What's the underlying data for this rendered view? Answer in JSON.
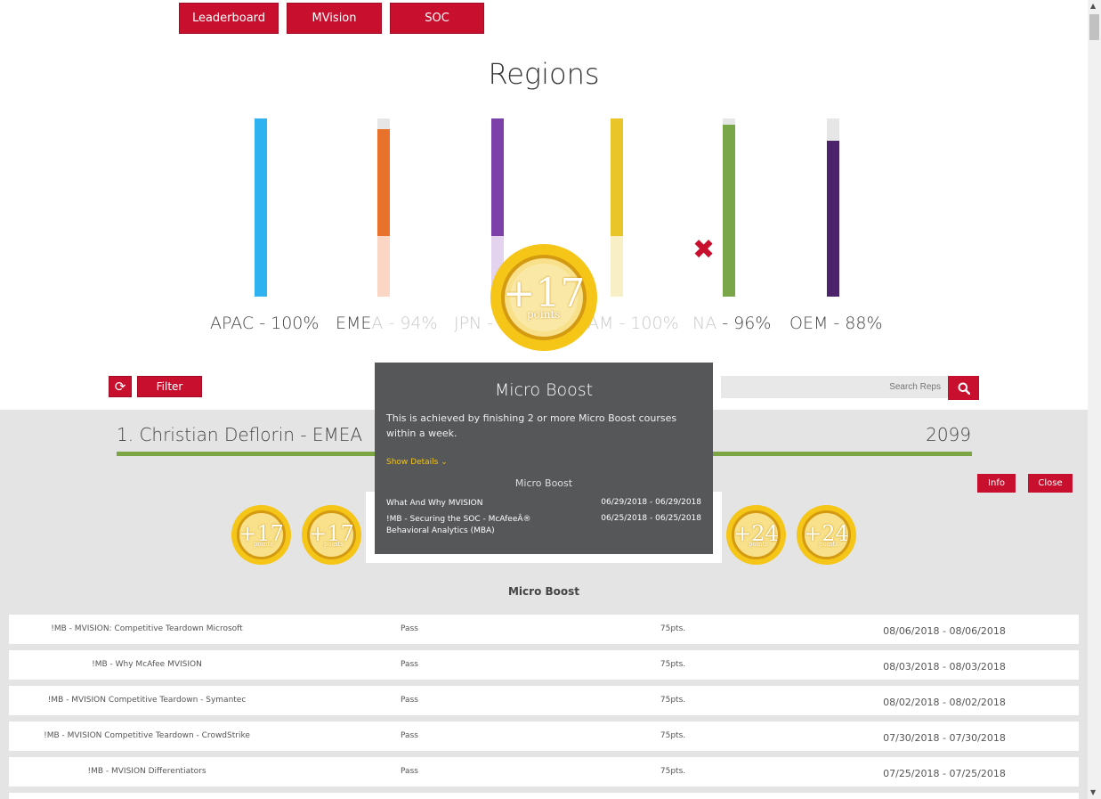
{
  "nav": {
    "buttons": [
      "Leaderboard",
      "MVision",
      "SOC"
    ]
  },
  "title": "Regions",
  "regions": [
    {
      "label": "APAC - 100%",
      "color": "#2fb2f0",
      "light": "#2fb2f0",
      "value": 100
    },
    {
      "label": "EMEA - 94%",
      "color": "#e8722c",
      "light": "#fcd6c4",
      "value": 94
    },
    {
      "label": "JPN - ",
      "color": "#7d3fa8",
      "light": "#e3d3ee",
      "value": 100
    },
    {
      "label": "AM - 100%",
      "color": "#e9c52a",
      "light": "#f8efc6",
      "value": 100
    },
    {
      "label": "NA - 96%",
      "color": "#7aa64a",
      "light": "#7aa64a",
      "value": 96
    },
    {
      "label": "OEM - 88%",
      "color": "#4c236b",
      "light": "#4c236b",
      "value": 88
    }
  ],
  "big_medal": {
    "number": "+17",
    "unit": "points"
  },
  "filter": {
    "label": "Filter",
    "search_placeholder": "Search Reps",
    "refresh_icon": "refresh-icon",
    "search_icon": "search-icon"
  },
  "rep": {
    "name": "1. Christian Deflorin - EMEA",
    "score": "2099",
    "info_label": "Info",
    "close_label": "Close"
  },
  "badges": [
    {
      "number": "+17",
      "unit": "points"
    },
    {
      "number": "+17",
      "unit": "points"
    },
    {
      "number": "+24",
      "unit": "points"
    },
    {
      "number": "+24",
      "unit": "points"
    }
  ],
  "section_heading": "Micro Boost",
  "rows": [
    {
      "name": "!MB - MVISION: Competitive Teardown Microsoft",
      "status": "Pass",
      "points": "75pts.",
      "date": "08/06/2018 - 08/06/2018"
    },
    {
      "name": "!MB - Why McAfee MVISION",
      "status": "Pass",
      "points": "75pts.",
      "date": "08/03/2018 - 08/03/2018"
    },
    {
      "name": "!MB - MVISION Competitive Teardown - Symantec",
      "status": "Pass",
      "points": "75pts.",
      "date": "08/02/2018 - 08/02/2018"
    },
    {
      "name": "!MB - MVISION Competitive Teardown - CrowdStrike",
      "status": "Pass",
      "points": "75pts.",
      "date": "07/30/2018 - 07/30/2018"
    },
    {
      "name": "!MB - MVISION Differentiators",
      "status": "Pass",
      "points": "75pts.",
      "date": "07/25/2018 - 07/25/2018"
    }
  ],
  "popup": {
    "title": "Micro Boost",
    "description": "This is achieved by finishing 2 or more Micro Boost courses within a week.",
    "show_details": "Show Details",
    "subtitle": "Micro Boost",
    "items": [
      {
        "name": "What And Why MVISION",
        "date": "06/29/2018 - 06/29/2018"
      },
      {
        "name": "!MB - Securing the SOC - McAfeeÂ® Behavioral Analytics (MBA)",
        "date": "06/25/2018 - 06/25/2018"
      }
    ]
  },
  "colors": {
    "accent": "#c8102e",
    "medal": "#f5c518"
  }
}
